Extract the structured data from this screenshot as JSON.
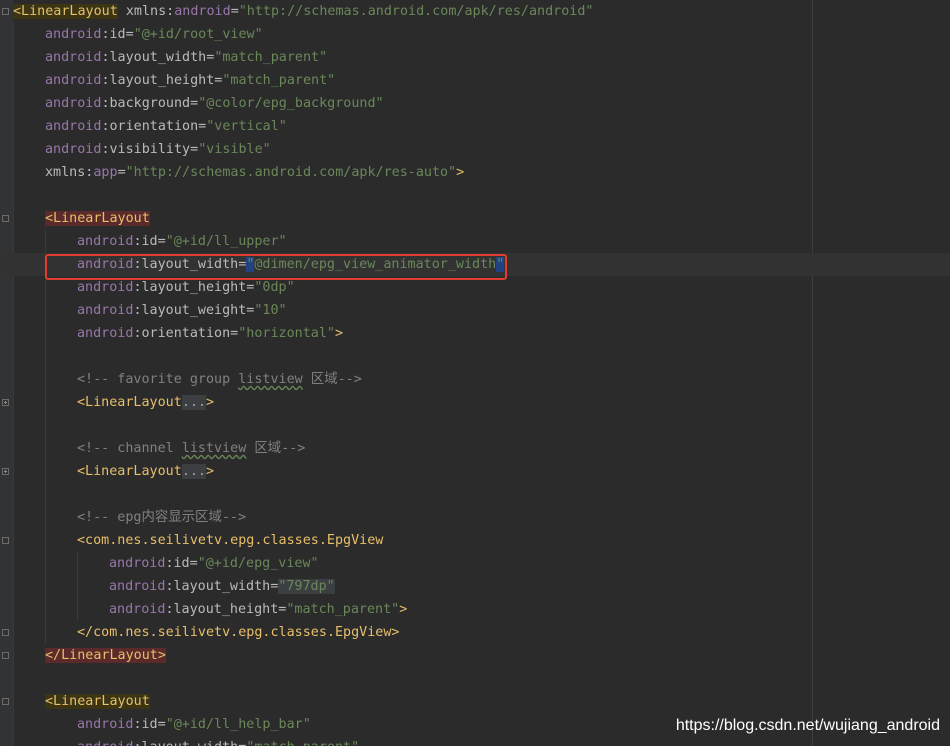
{
  "lines": [
    {
      "segs": [
        [
          "<LinearLayout",
          "tag-hl"
        ],
        [
          " xmlns:",
          "attr"
        ],
        [
          "android",
          "ns"
        ],
        [
          "=",
          "attr"
        ],
        [
          "\"http://schemas.android.com/apk/res/android\"",
          "str"
        ]
      ]
    },
    {
      "segs": [
        [
          "android",
          "ns"
        ],
        [
          ":id=",
          "attr"
        ],
        [
          "\"@+id/root_view\"",
          "str"
        ]
      ]
    },
    {
      "segs": [
        [
          "android",
          "ns"
        ],
        [
          ":layout_width=",
          "attr"
        ],
        [
          "\"match_parent\"",
          "str"
        ]
      ]
    },
    {
      "segs": [
        [
          "android",
          "ns"
        ],
        [
          ":layout_height=",
          "attr"
        ],
        [
          "\"match_parent\"",
          "str"
        ]
      ]
    },
    {
      "segs": [
        [
          "android",
          "ns"
        ],
        [
          ":background=",
          "attr"
        ],
        [
          "\"@color/epg_background\"",
          "str"
        ]
      ]
    },
    {
      "segs": [
        [
          "android",
          "ns"
        ],
        [
          ":orientation=",
          "attr"
        ],
        [
          "\"vertical\"",
          "str"
        ]
      ]
    },
    {
      "segs": [
        [
          "android",
          "ns"
        ],
        [
          ":visibility=",
          "attr"
        ],
        [
          "\"visible\"",
          "str"
        ]
      ]
    },
    {
      "segs": [
        [
          "xmlns:",
          "attr"
        ],
        [
          "app",
          "ns"
        ],
        [
          "=",
          "attr"
        ],
        [
          "\"http://schemas.android.com/apk/res-auto\"",
          "str"
        ],
        [
          ">",
          "tag"
        ]
      ]
    },
    {
      "segs": []
    },
    {
      "segs": [
        [
          "<LinearLayout",
          "tag-hl2"
        ]
      ]
    },
    {
      "segs": [
        [
          "android",
          "ns"
        ],
        [
          ":id=",
          "attr"
        ],
        [
          "\"@+id/ll_upper\"",
          "str"
        ]
      ]
    },
    {
      "segs": [
        [
          "android",
          "ns"
        ],
        [
          ":layout_width=",
          "attr"
        ],
        [
          "\"",
          "caret"
        ],
        [
          "@dimen/epg_view_animator_width",
          "str"
        ],
        [
          "\"",
          "caret"
        ]
      ]
    },
    {
      "segs": [
        [
          "android",
          "ns"
        ],
        [
          ":layout_height=",
          "attr"
        ],
        [
          "\"0dp\"",
          "str"
        ]
      ]
    },
    {
      "segs": [
        [
          "android",
          "ns"
        ],
        [
          ":layout_weight=",
          "attr"
        ],
        [
          "\"10\"",
          "str"
        ]
      ]
    },
    {
      "segs": [
        [
          "android",
          "ns"
        ],
        [
          ":orientation=",
          "attr"
        ],
        [
          "\"horizontal\"",
          "str"
        ],
        [
          ">",
          "tag"
        ]
      ]
    },
    {
      "segs": []
    },
    {
      "segs": [
        [
          "<!-- favorite group ",
          "cmt"
        ],
        [
          "listview",
          "cmt-sq"
        ],
        [
          " 区域-->",
          "cmt"
        ]
      ]
    },
    {
      "segs": [
        [
          "<LinearLayout",
          "tag"
        ],
        [
          "...",
          "folded"
        ],
        [
          ">",
          "tag"
        ]
      ]
    },
    {
      "segs": []
    },
    {
      "segs": [
        [
          "<!-- channel ",
          "cmt"
        ],
        [
          "listview",
          "cmt-sq"
        ],
        [
          " 区域-->",
          "cmt"
        ]
      ]
    },
    {
      "segs": [
        [
          "<LinearLayout",
          "tag"
        ],
        [
          "...",
          "folded"
        ],
        [
          ">",
          "tag"
        ]
      ]
    },
    {
      "segs": []
    },
    {
      "segs": [
        [
          "<!-- epg内容显示区域-->",
          "cmt"
        ]
      ]
    },
    {
      "segs": [
        [
          "<com.nes.seilivetv.epg.classes.EpgView",
          "tag"
        ]
      ]
    },
    {
      "segs": [
        [
          "android",
          "ns"
        ],
        [
          ":id=",
          "attr"
        ],
        [
          "\"@+id/epg_view\"",
          "str"
        ]
      ]
    },
    {
      "segs": [
        [
          "android",
          "ns"
        ],
        [
          ":layout_width=",
          "attr"
        ],
        [
          "\"797dp\"",
          "str-hl"
        ]
      ]
    },
    {
      "segs": [
        [
          "android",
          "ns"
        ],
        [
          ":layout_height=",
          "attr"
        ],
        [
          "\"match_parent\"",
          "str"
        ],
        [
          ">",
          "tag"
        ]
      ]
    },
    {
      "segs": [
        [
          "</com.nes.seilivetv.epg.classes.EpgView>",
          "tag"
        ]
      ]
    },
    {
      "segs": [
        [
          "</LinearLayout>",
          "tag-hl2"
        ]
      ]
    },
    {
      "segs": []
    },
    {
      "segs": [
        [
          "<LinearLayout",
          "tag-hl"
        ]
      ]
    },
    {
      "segs": [
        [
          "android",
          "ns"
        ],
        [
          ":id=",
          "attr"
        ],
        [
          "\"@+id/ll_help_bar\"",
          "str"
        ]
      ]
    },
    {
      "segs": [
        [
          "android",
          "ns"
        ],
        [
          ":layout_width=",
          "attr"
        ],
        [
          "\"match_parent\"",
          "str"
        ]
      ]
    }
  ],
  "watermark": "https://blog.csdn.net/wujiang_android"
}
